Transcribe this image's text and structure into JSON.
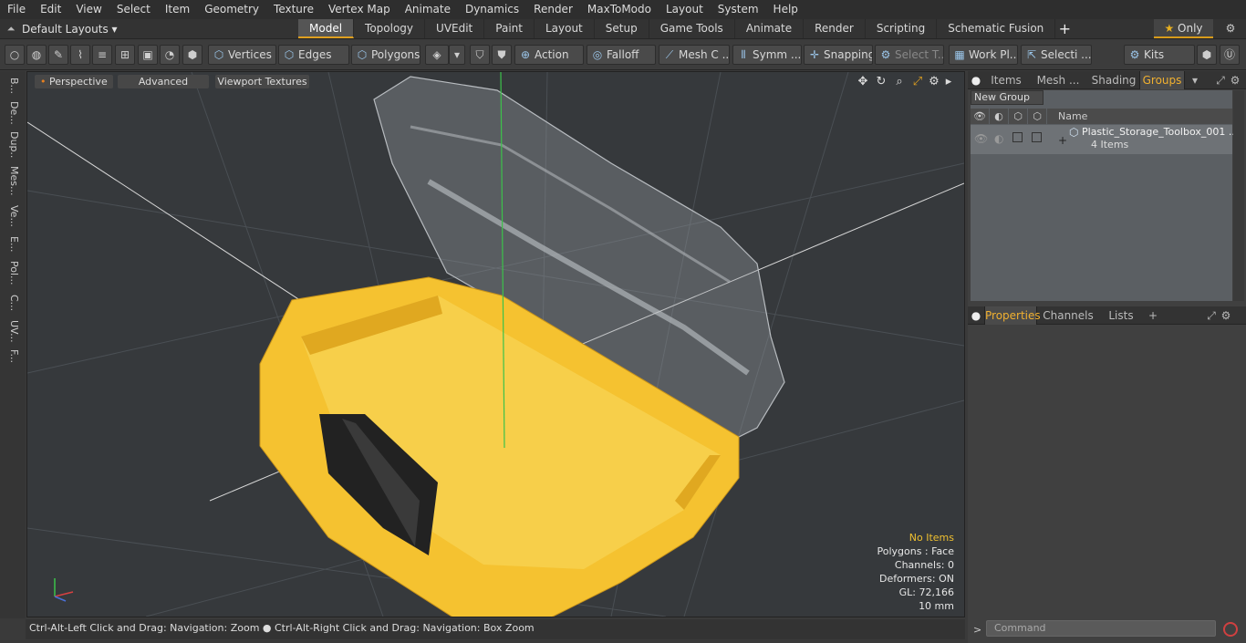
{
  "menu": [
    "File",
    "Edit",
    "View",
    "Select",
    "Item",
    "Geometry",
    "Texture",
    "Vertex Map",
    "Animate",
    "Dynamics",
    "Render",
    "MaxToModo",
    "Layout",
    "System",
    "Help"
  ],
  "layout": {
    "current": "Default Layouts"
  },
  "tabs": [
    "Model",
    "Topology",
    "UVEdit",
    "Paint",
    "Layout",
    "Setup",
    "Game Tools",
    "Animate",
    "Render",
    "Scripting",
    "Schematic Fusion"
  ],
  "only_label": "Only",
  "toolbar": {
    "vertices": "Vertices",
    "edges": "Edges",
    "polygons": "Polygons",
    "action": "Action",
    "falloff": "Falloff",
    "mesh": "Mesh C ...",
    "symm": "Symm ...",
    "snapping": "Snapping",
    "select_t": "Select T...",
    "work_pl": "Work Pl...",
    "selecti": "Selecti ...",
    "kits": "Kits"
  },
  "left_tabs": [
    "B...",
    "De...",
    "Dup...",
    "Mes...",
    "Ve...",
    "E...",
    "Pol...",
    "C...",
    "UV...",
    "F..."
  ],
  "viewport": {
    "perspective": "Perspective",
    "advanced": "Advanced",
    "textures": "Viewport Textures",
    "info": {
      "no_items": "No Items",
      "polygons": "Polygons : Face",
      "channels": "Channels: 0",
      "deformers": "Deformers: ON",
      "gl": "GL: 72,166",
      "unit": "10 mm"
    },
    "colors": {
      "object": "#f5c230",
      "background": "#36393c"
    }
  },
  "status": "Ctrl-Alt-Left Click and Drag: Navigation: Zoom ● Ctrl-Alt-Right Click and Drag: Navigation: Box Zoom",
  "panels": {
    "top_tabs": [
      "Items",
      "Mesh ...",
      "Shading",
      "Groups"
    ],
    "new_group": "New Group",
    "name_header": "Name",
    "group_name": "Plastic_Storage_Toolbox_001 ...",
    "group_count": "4 Items",
    "bottom_tabs": [
      "Properties",
      "Channels",
      "Lists"
    ],
    "command_placeholder": "Command"
  }
}
